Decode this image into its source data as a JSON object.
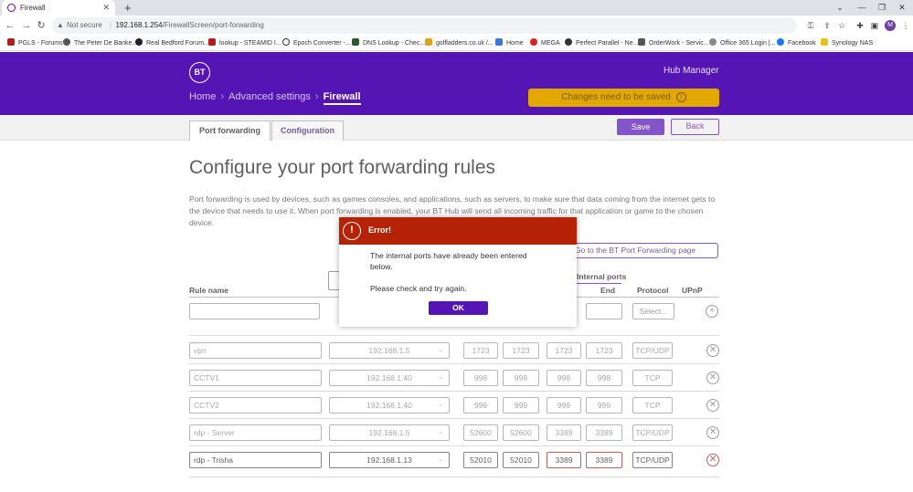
{
  "browser": {
    "tab_title": "Firewall",
    "url_warning": "Not secure",
    "url_host": "192.168.1.254",
    "url_path": "/FirewallScreen/port-forwarding",
    "profile_initial": "M",
    "bookmarks": [
      "PGLS - Forums",
      "The Peter De Banke...",
      "Real Bedford Forum...",
      "lookup - STEAMID I...",
      "Epoch Converter -...",
      "DNS Lookup - Chec...",
      "golfladders.co.uk /...",
      "Home",
      "MEGA",
      "Perfect Parallel - Ne...",
      "OrderWork - Servic...",
      "Office 365 Login |...",
      "Facebook",
      "Synology NAS"
    ]
  },
  "header": {
    "logo": "BT",
    "hub_manager": "Hub Manager",
    "breadcrumb": {
      "home": "Home",
      "advanced": "Advanced settings",
      "current": "Firewall"
    },
    "changes_banner": "Changes need to be saved",
    "brand_color": "#5514b4"
  },
  "subnav": {
    "tab_port_forwarding": "Port forwarding",
    "tab_configuration": "Configuration",
    "save": "Save",
    "back": "Back"
  },
  "main": {
    "title": "Configure your port forwarding rules",
    "description": "Port forwarding is used by devices, such as games consoles, and applications, such as servers, to make sure that data coming from the internet gets to the device that needs to use it. When port forwarding is enabled, your BT Hub will send all incoming traffic for that application or game to the chosen device.",
    "goto_link": "Go to the BT Port Forwarding page",
    "columns": {
      "rule_name": "Rule name",
      "internal_ports": "Internal ports",
      "end": "End",
      "protocol": "Protocol",
      "upnp": "UPnP"
    },
    "new_row": {
      "protocol_placeholder": "Select..."
    },
    "rules": [
      {
        "name": "vpn",
        "device": "192.168.1.5",
        "ext_start": "1723",
        "ext_end": "1723",
        "int_start": "1723",
        "int_end": "1723",
        "protocol": "TCP/UDP"
      },
      {
        "name": "CCTV1",
        "device": "192.168.1.40",
        "ext_start": "998",
        "ext_end": "998",
        "int_start": "998",
        "int_end": "998",
        "protocol": "TCP"
      },
      {
        "name": "CCTV2",
        "device": "192.168.1.40",
        "ext_start": "999",
        "ext_end": "999",
        "int_start": "999",
        "int_end": "999",
        "protocol": "TCP"
      },
      {
        "name": "rdp - Server",
        "device": "192.168.1.5",
        "ext_start": "52600",
        "ext_end": "52600",
        "int_start": "3389",
        "int_end": "3389",
        "protocol": "TCP/UDP"
      },
      {
        "name": "rdp - Trisha",
        "device": "192.168.1.13",
        "ext_start": "52010",
        "ext_end": "52010",
        "int_start": "3389",
        "int_end": "3389",
        "protocol": "TCP/UDP"
      }
    ]
  },
  "dialog": {
    "title": "Error!",
    "message": "The internal ports have already been entered below.",
    "message2": "Please check and try again.",
    "ok": "OK",
    "header_color": "#b52206"
  }
}
